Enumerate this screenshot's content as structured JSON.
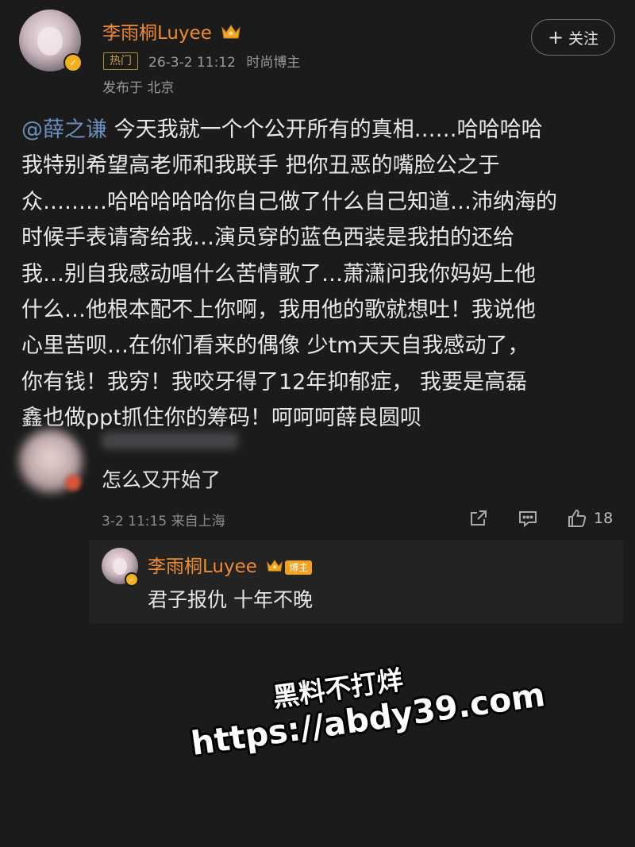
{
  "post": {
    "author": "李雨桐Luyee",
    "hot_tag": "热门",
    "timestamp": "26-3-2 11:12",
    "category": "时尚博主",
    "location": "发布于 北京",
    "follow_label": "关注",
    "mention": "@薛之谦",
    "lines": [
      " 今天我就一个个公开所有的真相……哈哈哈哈",
      "我特别希望高老师和我联手 把你丑恶的嘴脸公之于",
      "众………哈哈哈哈哈你自己做了什么自己知道…沛纳海的",
      "时候手表请寄给我…演员穿的蓝色西装是我拍的还给",
      "我…别自我感动唱什么苦情歌了…萧潇问我你妈妈上他",
      "什么…他根本配不上你啊，我用他的歌就想吐！我说他",
      "心里苦呗…在你们看来的偶像 少tm天天自我感动了，",
      "你有钱！我穷！我咬牙得了12年抑郁症， 我要是高磊",
      "鑫也做ppt抓住你的筹码！呵呵呵薛良圆呗"
    ]
  },
  "comment": {
    "text": "怎么又开始了",
    "meta": "3-2 11:15 来自上海",
    "likes": "18"
  },
  "reply": {
    "author": "李雨桐Luyee",
    "author_tag": "博主",
    "text": "君子报仇 十年不晚"
  },
  "watermark": {
    "line1": "黑料不打烊",
    "line2": "https://abdy39.com"
  },
  "colors": {
    "background": "#1b1b1c",
    "username": "#ef8a32",
    "mention": "#6a8fb9",
    "badge": "#f3b21c"
  },
  "icons": [
    "crown-icon",
    "verified-badge-icon",
    "plus-icon",
    "share-icon",
    "comment-icon",
    "like-icon"
  ]
}
